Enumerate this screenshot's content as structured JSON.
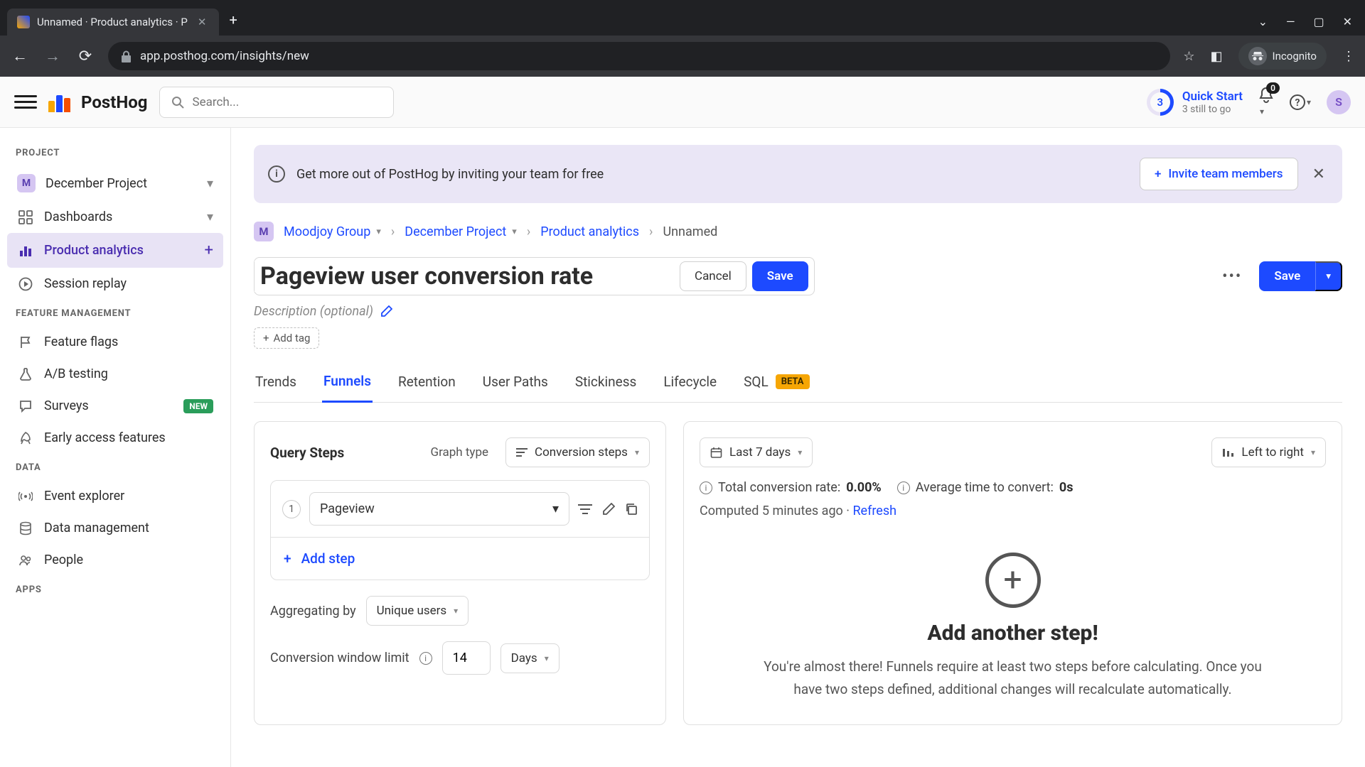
{
  "browser": {
    "tab_title": "Unnamed · Product analytics · P",
    "url": "app.posthog.com/insights/new",
    "incognito_label": "Incognito"
  },
  "header": {
    "search_placeholder": "Search...",
    "quick_start": {
      "badge": "3",
      "title": "Quick Start",
      "subtitle": "3 still to go"
    },
    "notifications_count": "0",
    "avatar_initial": "S"
  },
  "sidebar": {
    "sections": {
      "project": "PROJECT",
      "feature_mgmt": "FEATURE MANAGEMENT",
      "data": "DATA",
      "apps": "APPS"
    },
    "project_name": "December Project",
    "project_initial": "M",
    "items": {
      "dashboards": "Dashboards",
      "product_analytics": "Product analytics",
      "session_replay": "Session replay",
      "feature_flags": "Feature flags",
      "ab_testing": "A/B testing",
      "surveys": "Surveys",
      "early_access": "Early access features",
      "event_explorer": "Event explorer",
      "data_mgmt": "Data management",
      "people": "People"
    },
    "new_badge": "NEW"
  },
  "banner": {
    "text": "Get more out of PostHog by inviting your team for free",
    "invite_button": "Invite team members"
  },
  "breadcrumb": {
    "org": "Moodjoy Group",
    "org_initial": "M",
    "project": "December Project",
    "section": "Product analytics",
    "current": "Unnamed"
  },
  "insight": {
    "title": "Pageview user conversion rate",
    "cancel": "Cancel",
    "save": "Save",
    "save_main": "Save",
    "description_placeholder": "Description (optional)",
    "add_tag": "Add tag"
  },
  "tabs": {
    "trends": "Trends",
    "funnels": "Funnels",
    "retention": "Retention",
    "user_paths": "User Paths",
    "stickiness": "Stickiness",
    "lifecycle": "Lifecycle",
    "sql": "SQL",
    "beta": "BETA"
  },
  "query": {
    "title": "Query Steps",
    "graph_type_label": "Graph type",
    "graph_type_value": "Conversion steps",
    "step1": {
      "num": "1",
      "event": "Pageview"
    },
    "add_step": "Add step",
    "aggregate_label": "Aggregating by",
    "aggregate_value": "Unique users",
    "conv_window_label": "Conversion window limit",
    "conv_window_value": "14",
    "conv_window_unit": "Days"
  },
  "results": {
    "date_range": "Last 7 days",
    "direction": "Left to right",
    "conv_rate_label": "Total conversion rate:",
    "conv_rate_value": "0.00%",
    "avg_time_label": "Average time to convert:",
    "avg_time_value": "0s",
    "computed_prefix": "Computed ",
    "computed_time": "5 minutes ago",
    "computed_sep": " · ",
    "refresh": "Refresh",
    "empty_title": "Add another step!",
    "empty_desc": "You're almost there! Funnels require at least two steps before calculating. Once you have two steps defined, additional changes will recalculate automatically."
  }
}
